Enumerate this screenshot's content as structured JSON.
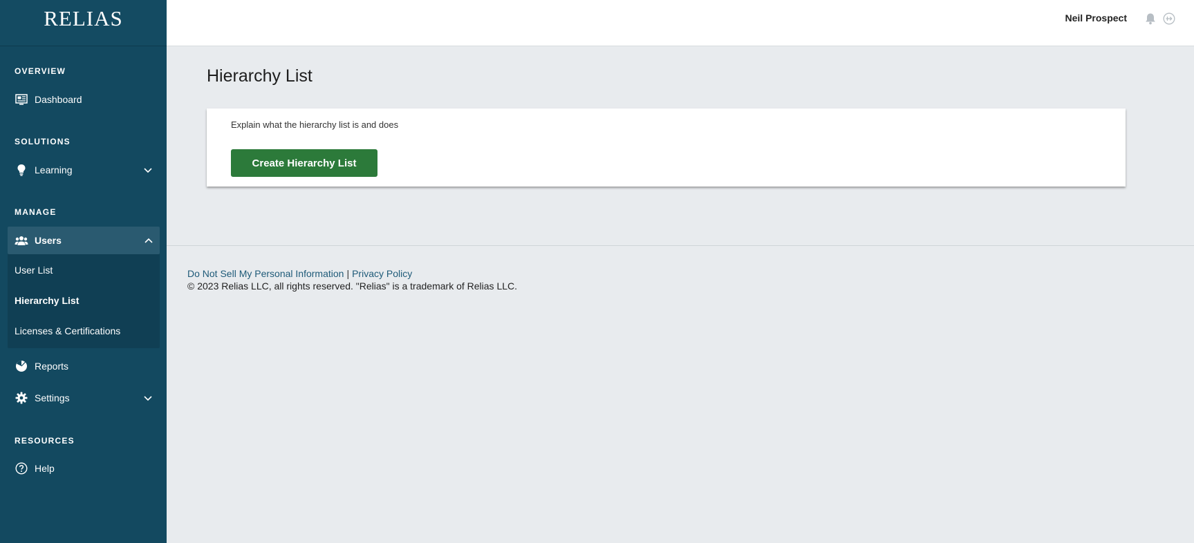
{
  "brand": {
    "logo_text": "RELIAS"
  },
  "sidebar": {
    "overview_label": "OVERVIEW",
    "dashboard_label": "Dashboard",
    "solutions_label": "SOLUTIONS",
    "learning_label": "Learning",
    "manage_label": "MANAGE",
    "users_label": "Users",
    "users_subitems": [
      "User List",
      "Hierarchy List",
      "Licenses & Certifications"
    ],
    "reports_label": "Reports",
    "settings_label": "Settings",
    "resources_label": "RESOURCES",
    "help_label": "Help"
  },
  "topbar": {
    "username": "Neil Prospect"
  },
  "main": {
    "title": "Hierarchy List",
    "description": "Explain what the hierarchy list is and does",
    "create_button": "Create Hierarchy List"
  },
  "footer": {
    "do_not_sell": "Do Not Sell My Personal Information",
    "separator": "|",
    "privacy": "Privacy Policy",
    "copyright": "© 2023 Relias LLC, all rights reserved. \"Relias\" is a trademark of Relias LLC."
  },
  "colors": {
    "sidebar_bg": "#134960",
    "accent_green": "#2c7a3a",
    "link_blue": "#1e5a78",
    "page_bg": "#e8ebee"
  }
}
